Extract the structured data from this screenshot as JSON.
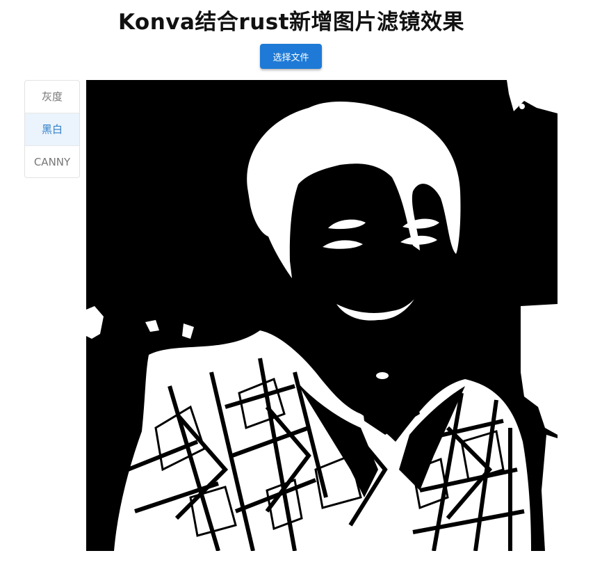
{
  "page": {
    "title": "Konva结合rust新增图片滤镜效果"
  },
  "toolbar": {
    "file_button_label": "选择文件"
  },
  "filters": {
    "items": [
      {
        "label": "灰度",
        "active": false
      },
      {
        "label": "黑白",
        "active": true
      },
      {
        "label": "CANNY",
        "active": false
      }
    ]
  },
  "canvas": {
    "active_filter": "黑白",
    "foreground_color": "#ffffff",
    "background_color": "#000000"
  },
  "colors": {
    "accent": "#1e7ad6",
    "active_item_bg": "#ebf3fc",
    "active_item_text": "#2f7fc9"
  }
}
